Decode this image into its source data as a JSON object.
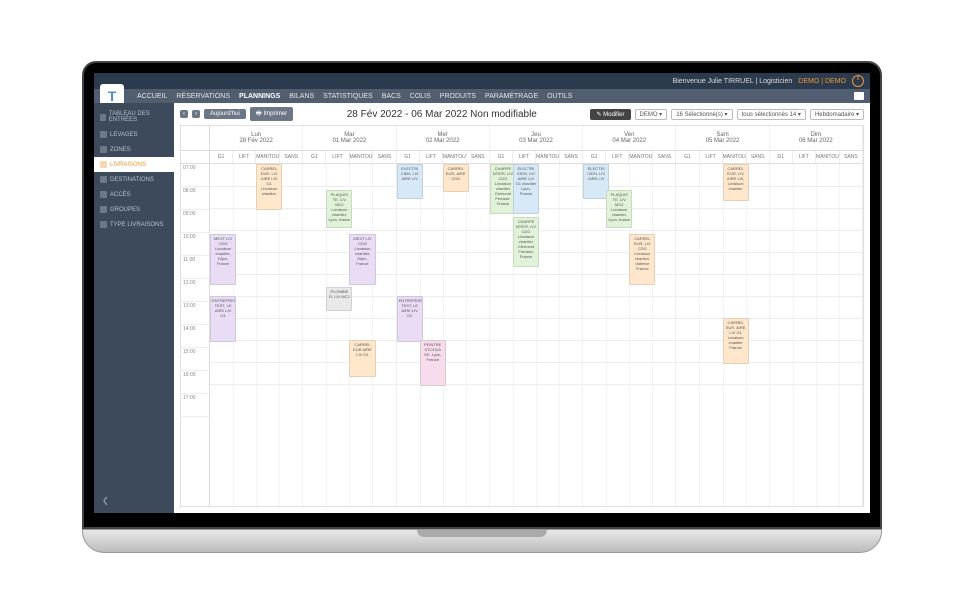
{
  "header": {
    "welcome": "Bienvenue Julie TIRRUEL | Logisticien",
    "demo": "DEMO | DEMO"
  },
  "menu": {
    "items": [
      "ACCUEIL",
      "RÉSERVATIONS",
      "PLANNINGS",
      "BILANS",
      "STATISTIQUES",
      "BACS",
      "COLIS",
      "PRODUITS",
      "PARAMÉTRAGE",
      "OUTILS"
    ],
    "active": "PLANNINGS"
  },
  "sidebar": {
    "items": [
      {
        "label": "TABLEAU DES ENTRÉES"
      },
      {
        "label": "LEVAGES"
      },
      {
        "label": "ZONES"
      },
      {
        "label": "LIVRAISONS",
        "active": true
      },
      {
        "label": "DESTINATIONS"
      },
      {
        "label": "ACCÈS"
      },
      {
        "label": "GROUPES"
      },
      {
        "label": "TYPE LIVRAISONS"
      }
    ]
  },
  "toolbar": {
    "prev": "‹",
    "next": "›",
    "today": "Aujourd'hui",
    "print": "Imprimer",
    "title": "28 Fév 2022 - 06 Mar 2022 Non modifiable",
    "modify": "✎ Modifier",
    "sel1": "DEMO ▾",
    "sel2": "16 Sélectionné(s) ▾",
    "sel3": "tous sélectionnés 14 ▾",
    "sel4": "Hebdomadaire ▾"
  },
  "days": [
    {
      "name": "Lun",
      "date": "28 Fév 2022"
    },
    {
      "name": "Mar",
      "date": "01 Mar 2022"
    },
    {
      "name": "Mer",
      "date": "02 Mar 2022"
    },
    {
      "name": "Jeu",
      "date": "03 Mar 2022"
    },
    {
      "name": "Ven",
      "date": "04 Mar 2022"
    },
    {
      "name": "Sam",
      "date": "05 Mar 2022"
    },
    {
      "name": "Dim",
      "date": "06 Mar 2022"
    }
  ],
  "resources": [
    "G1",
    "LIFT",
    "MANITOU",
    "SANS"
  ],
  "hours": [
    "07:00",
    "08:00",
    "09:00",
    "10:00",
    "11:00",
    "12:00",
    "13:00",
    "14:00",
    "15:00",
    "16:00",
    "17:00"
  ],
  "events": [
    {
      "day": 0,
      "col": 2,
      "start": 0,
      "dur": 2,
      "color": "c-orange",
      "text": "CARREL EUR, LIV AIRE LIV G1 Livraison chantier,"
    },
    {
      "day": 0,
      "col": 0,
      "start": 3.2,
      "dur": 2.2,
      "color": "c-purple",
      "text": "MEXT LIV CDG Livraison chantier, Dijon, France"
    },
    {
      "day": 0,
      "col": 0,
      "start": 6,
      "dur": 2,
      "color": "c-purple",
      "text": "ENTREPRISE TEST, LE AIRE LIV G1"
    },
    {
      "day": 1,
      "col": 1,
      "start": 1.2,
      "dur": 1.6,
      "color": "c-green",
      "text": "PLAQUIS TE, LIV MC2 Livraison chantier, Lyon, france"
    },
    {
      "day": 1,
      "col": 2,
      "start": 3.2,
      "dur": 2.2,
      "color": "c-purple",
      "text": "MEXT LIV CDG Livraison chantier, Dijon, France"
    },
    {
      "day": 1,
      "col": 1,
      "start": 5.6,
      "dur": 1,
      "color": "c-grey",
      "text": "PLOMBIE R, LIV MC2"
    },
    {
      "day": 1,
      "col": 2,
      "start": 8,
      "dur": 1.6,
      "color": "c-orange",
      "text": "CARREL EUR AIRE LIV G1"
    },
    {
      "day": 2,
      "col": 0,
      "start": 0,
      "dur": 1.5,
      "color": "c-blue",
      "text": "ELECTRI CIEN, LIV AIRE LIV"
    },
    {
      "day": 2,
      "col": 2,
      "start": 0,
      "dur": 1.2,
      "color": "c-orange",
      "text": "CARREL EUR, AIRE CDG"
    },
    {
      "day": 2,
      "col": 0,
      "start": 6,
      "dur": 2,
      "color": "c-purple",
      "text": "ENTREPRISE TEST, LE AIRE LIV G1"
    },
    {
      "day": 2,
      "col": 1,
      "start": 8,
      "dur": 2,
      "color": "c-pink",
      "text": "PEINTRE STOCKA GE, Lyon, France"
    },
    {
      "day": 3,
      "col": 0,
      "start": 0,
      "dur": 2.2,
      "color": "c-green",
      "text": "CHARPE NTIER, LIV CDG Livraison chantier Clermont Ferrand, France"
    },
    {
      "day": 3,
      "col": 1,
      "start": 0,
      "dur": 2.2,
      "color": "c-blue",
      "text": "ELECTRI CIEN, LIV AIRE LIV G1 chantier Lyon, France"
    },
    {
      "day": 3,
      "col": 1,
      "start": 2.4,
      "dur": 2.2,
      "color": "c-green",
      "text": "CHARPE NTIER, LIV CDG Livraison chantier Clermont Ferrand, France"
    },
    {
      "day": 4,
      "col": 0,
      "start": 0,
      "dur": 1.5,
      "color": "c-blue",
      "text": "ELECTRI CIEN, LIV AIRE LIV"
    },
    {
      "day": 4,
      "col": 1,
      "start": 1.2,
      "dur": 1.6,
      "color": "c-green",
      "text": "PLAQUIS TE, LIV MC2 Livraison chantier, Lyon, france"
    },
    {
      "day": 4,
      "col": 2,
      "start": 3.2,
      "dur": 2.2,
      "color": "c-orange",
      "text": "CARREL EUR, LIV CDG Livraison chantier, Valence France"
    },
    {
      "day": 5,
      "col": 2,
      "start": 0,
      "dur": 1.6,
      "color": "c-orange",
      "text": "CARREL EUR, LIV AIRE LIV, Livraison chantier"
    },
    {
      "day": 5,
      "col": 2,
      "start": 7,
      "dur": 2,
      "color": "c-orange",
      "text": "CARREL EUR, AIRE LIV G1 Livraison chantier France"
    }
  ]
}
